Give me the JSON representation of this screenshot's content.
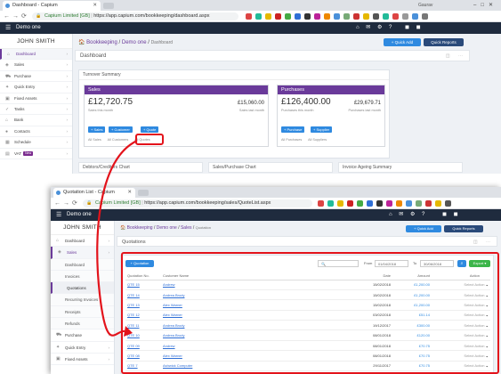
{
  "colors": {
    "purple": "#6a3a9a",
    "blue": "#2f8ae0",
    "navy": "#1f2b3e",
    "red": "#e3131b",
    "green": "#3cb54a"
  },
  "window1": {
    "tab_title": "Dashboard - Capium",
    "profile": "Gaurav",
    "url_secure": "Capium Limited [GB]",
    "url": "https://app.capium.com/bookkeeping/dashboard.aspx",
    "company": "Demo one",
    "quick_add": "+ Quick Add",
    "quick_reports": "Quick Reports",
    "user_name": "JOHN SMITH",
    "menu": [
      {
        "label": "Dashboard",
        "icon": "home-icon",
        "active": true
      },
      {
        "label": "Sales",
        "icon": "tag-icon"
      },
      {
        "label": "Purchase",
        "icon": "cart-icon"
      },
      {
        "label": "Quick Entry",
        "icon": "bolt-icon"
      },
      {
        "label": "Fixed Assets",
        "icon": "box-icon"
      },
      {
        "label": "Tasks",
        "icon": "check-icon"
      },
      {
        "label": "Bank",
        "icon": "bank-icon"
      },
      {
        "label": "Contacts",
        "icon": "user-icon"
      },
      {
        "label": "Schedule",
        "icon": "calendar-icon"
      },
      {
        "label": "VAT",
        "icon": "file-icon",
        "badge": "New"
      }
    ],
    "breadcrumb": {
      "root": "Bookkeeping",
      "company": "Demo one",
      "page": "Dashboard"
    },
    "page_title": "Dashboard",
    "turnover": {
      "title": "Turnover Summary",
      "sales": {
        "header": "Sales",
        "amount_month": "£12,720.75",
        "label_month": "Sales this month",
        "amount_last": "£15,060.00",
        "label_last": "Sales last month",
        "buttons": [
          "+ Sales",
          "+ Customer",
          "+ Quote"
        ],
        "links": [
          "All Sales",
          "All Customers",
          "All Quotes"
        ]
      },
      "purchases": {
        "header": "Purchases",
        "amount_month": "£126,400.00",
        "label_month": "Purchases this month",
        "amount_last": "£29,679.71",
        "label_last": "Purchases last month",
        "buttons": [
          "+ Purchase",
          "+ Supplier"
        ],
        "links": [
          "All Purchases",
          "All Suppliers"
        ]
      }
    },
    "lower_cards": [
      "Debtors/Creditors Chart",
      "Sales/Purchase Chart",
      "Invoice Ageing Summary"
    ]
  },
  "window2": {
    "tab_title": "Quotation List - Capium",
    "url_secure": "Capium Limited [GB]",
    "url": "https://app.capium.com/bookkeeping/sales/QuoteList.aspx",
    "company": "Demo one",
    "quick_add": "+ Quick Add",
    "quick_reports": "Quick Reports",
    "user_name": "JOHN SMITH",
    "menu": [
      {
        "label": "Dashboard",
        "icon": "home-icon"
      },
      {
        "label": "Sales",
        "icon": "tag-icon",
        "active": true
      },
      {
        "label": "Dashboard",
        "sub": true
      },
      {
        "label": "Invoices",
        "sub": true
      },
      {
        "label": "Quotations",
        "sub": true,
        "active": true
      },
      {
        "label": "Recurring Invoices",
        "sub": true
      },
      {
        "label": "Receipts",
        "sub": true
      },
      {
        "label": "Refunds",
        "sub": true
      },
      {
        "label": "Purchase",
        "icon": "cart-icon"
      },
      {
        "label": "Quick Entry",
        "icon": "bolt-icon"
      },
      {
        "label": "Fixed Assets",
        "icon": "box-icon"
      }
    ],
    "breadcrumb": {
      "root": "Bookkeeping",
      "company": "Demo one",
      "section": "Sales",
      "page": "Quotation"
    },
    "page_title": "Quotations",
    "add_button": "+ Quotation",
    "from_label": "From",
    "from_date": "01/04/2018",
    "to_label": "To",
    "to_date": "30/06/2018",
    "export_label": "Export",
    "columns": [
      "Quotation No.",
      "Customer Name",
      "Date",
      "Amount",
      "Action"
    ],
    "rows": [
      {
        "no": "QTE 15",
        "customer": "Andrew",
        "date": "15/02/2018",
        "amount": "£1,200.00",
        "action": "Select Action"
      },
      {
        "no": "QTE 14",
        "customer": "Andrea Brody",
        "date": "15/02/2018",
        "amount": "£1,200.00",
        "action": "Select Action"
      },
      {
        "no": "QTE 13",
        "customer": "Alex Warner",
        "date": "15/02/2018",
        "amount": "£1,200.00",
        "action": "Select Action"
      },
      {
        "no": "QTE 12",
        "customer": "Alex Warner",
        "date": "03/02/2018",
        "amount": "£51.14",
        "action": "Select Action"
      },
      {
        "no": "QTE 11",
        "customer": "Andrea Brody",
        "date": "19/12/2017",
        "amount": "£300.00",
        "action": "Select Action"
      },
      {
        "no": "QTE 10",
        "customer": "Andrea Brody",
        "date": "08/01/2018",
        "amount": "£120.00",
        "action": "Select Action"
      },
      {
        "no": "QTE 09",
        "customer": "Andrew",
        "date": "08/01/2018",
        "amount": "£70.75",
        "action": "Select Action"
      },
      {
        "no": "QTE 08",
        "customer": "Alex Warner",
        "date": "08/01/2018",
        "amount": "£70.75",
        "action": "Select Action"
      },
      {
        "no": "QTE 7",
        "customer": "Ashwick Computer",
        "date": "29/11/2017",
        "amount": "£70.75",
        "action": "Select Action"
      }
    ]
  }
}
